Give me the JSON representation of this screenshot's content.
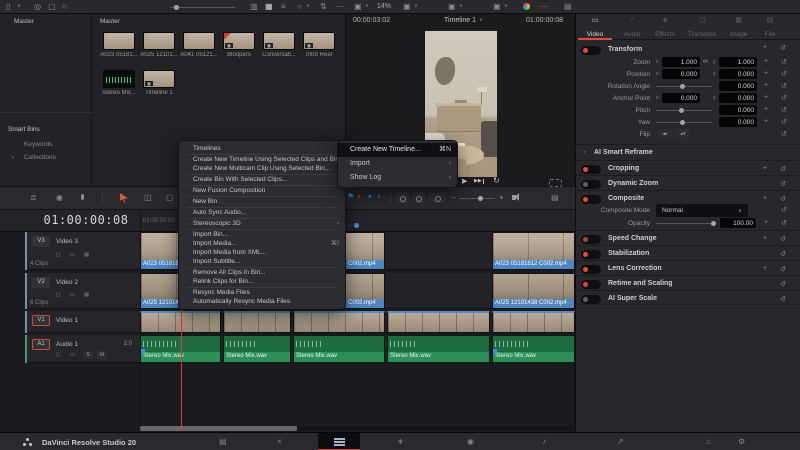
{
  "colors": {
    "accent_red": "#e8483b",
    "selection_blue": "#3f8fe0",
    "clip_label_blue": "#4b86c2",
    "audio_green": "#2a9057",
    "panel_bg": "#28282d",
    "menu_bg": "#2c2c32"
  },
  "topbar": {
    "zoom_level": "14%",
    "clip_title": "A023 05181812 C002.mp4"
  },
  "bin_panel": {
    "root_item": "Master",
    "smart_bins_label": "Smart Bins",
    "keywords_label": "Keywords",
    "collections_label": "Collections"
  },
  "media_pool": {
    "header": "Master",
    "clips": [
      {
        "label": "A023 05181..."
      },
      {
        "label": "A025 12101..."
      },
      {
        "label": "A041 05121..."
      },
      {
        "label": "Bloopers"
      },
      {
        "label": "Conversati..."
      },
      {
        "label": "Intro Reel"
      },
      {
        "label": "Stereo Mix..."
      },
      {
        "label": "Timeline 1"
      }
    ]
  },
  "viewer": {
    "source_timecode": "00:00:03:02",
    "timeline_name": "Timeline 1",
    "record_timecode": "01:00:00:08"
  },
  "context_menu": {
    "items": [
      {
        "label": "Timelines"
      },
      {
        "label": "Create New Timeline Using Selected Clips and Bins..."
      },
      {
        "label": "Create New Multicam Clip Using Selected Bin..."
      },
      {
        "label": "Create Bin With Selected Clips..."
      },
      {
        "label": "New Fusion Composition"
      },
      {
        "label": "New Bin"
      },
      {
        "label": "Auto Sync Audio..."
      },
      {
        "label": "Stereoscopic 3D"
      },
      {
        "label": "Import Bin..."
      },
      {
        "label": "Import Media...",
        "shortcut": "⌘I"
      },
      {
        "label": "Import Media from XML..."
      },
      {
        "label": "Import Subtitle..."
      },
      {
        "label": "Remove All Clips in Bin..."
      },
      {
        "label": "Relink Clips for Bin..."
      },
      {
        "label": "Resync Media Files"
      },
      {
        "label": "Automatically Resync Media Files"
      }
    ]
  },
  "submenu": {
    "items": [
      {
        "label": "Create New Timeline...",
        "shortcut": "⌘N"
      },
      {
        "label": "Import"
      },
      {
        "label": "Show Log"
      }
    ]
  },
  "inspector": {
    "header_title": "A023 05181812 C002.mp4",
    "tabs": [
      {
        "label": "Video"
      },
      {
        "label": "Audio"
      },
      {
        "label": "Effects"
      },
      {
        "label": "Transition"
      },
      {
        "label": "Image"
      },
      {
        "label": "File"
      }
    ],
    "transform": {
      "title": "Transform",
      "zoom": {
        "label": "Zoom",
        "x": "1.000",
        "y": "1.000"
      },
      "position": {
        "label": "Position",
        "x": "0.000",
        "y": "0.000"
      },
      "rotation": {
        "label": "Rotation Angle",
        "value": "0.000"
      },
      "anchor": {
        "label": "Anchor Point",
        "x": "0.000",
        "y": "0.000"
      },
      "pitch": {
        "label": "Pitch",
        "value": "0.000"
      },
      "yaw": {
        "label": "Yaw",
        "value": "0.000"
      },
      "flip_label": "Flip"
    },
    "sections": [
      {
        "label": "AI Smart Reframe"
      },
      {
        "label": "Cropping",
        "toggle": "on"
      },
      {
        "label": "Dynamic Zoom",
        "toggle": "off"
      },
      {
        "label": "Composite",
        "toggle": "on"
      },
      {
        "label": "Speed Change",
        "toggle": "dim"
      },
      {
        "label": "Stabilization",
        "toggle": "on"
      },
      {
        "label": "Lens Correction",
        "toggle": "on"
      },
      {
        "label": "Retime and Scaling",
        "toggle": "on"
      },
      {
        "label": "AI Super Scale",
        "toggle": "off"
      }
    ],
    "composite": {
      "mode_label": "Composite Mode",
      "mode_value": "Normal",
      "opacity_label": "Opacity",
      "opacity_value": "100.00"
    }
  },
  "timeline": {
    "playhead_timecode": "01:00:00:08",
    "ruler_start_label": "01:00:00:00",
    "tracks": [
      {
        "badge": "V3",
        "name": "Video 3",
        "meta": "4 Clips"
      },
      {
        "badge": "V2",
        "name": "Video 2",
        "meta": "6 Clips"
      },
      {
        "badge": "V1",
        "name": "Video 1"
      },
      {
        "badge": "A1",
        "name": "Audio 1",
        "channels": "2.0"
      }
    ],
    "v3_clip_name": "A023 05181812 C002.mp4",
    "v2_clip_name": "A025 12101438 C002.mp4",
    "audio_clip_name": "Stereo Mix.wav",
    "solo_label": "S",
    "mute_label": "M"
  },
  "bottom_bar": {
    "app_name": "DaVinci Resolve Studio 20",
    "pages": [
      "Media",
      "Cut",
      "Edit",
      "Fusion",
      "Color",
      "Fairlight",
      "Deliver"
    ],
    "active_page": "Edit"
  },
  "icons": {
    "chevron_down": "∨",
    "submenu_arrow": "›",
    "more": "⋯",
    "reset": "↺",
    "keyframe_add": "+",
    "minus": "−",
    "plus": "+",
    "play": "▶",
    "skip": "▶▶",
    "loop": "↻",
    "flag": "⚑",
    "marker": "●",
    "eye": "◉",
    "menu_lines": "≣",
    "panel": "▯",
    "ring": "◎",
    "box": "▢",
    "circle": "○",
    "strip_view": "▥",
    "grid_view": "▦",
    "list_view": "≡",
    "sort": "⇅",
    "bin_view": "▣",
    "usage": "▤",
    "note": "♪",
    "video_tab": "▭",
    "fx_tab": "◈",
    "transition_tab": "◫",
    "image_tab": "▦",
    "file_tab": "▤",
    "link": "∞",
    "flip_h": "◂▸",
    "flip_v": "▴▾",
    "lock": "◻",
    "enable": "▭",
    "grid_small": "▦",
    "home": "⌂",
    "gear": "⚙",
    "media_page": "▤",
    "cut_page": "×",
    "fusion_page": "∗",
    "color_page": "◉",
    "fairlight_page": "♪",
    "deliver_page": "↗",
    "checkmark": "✓"
  }
}
